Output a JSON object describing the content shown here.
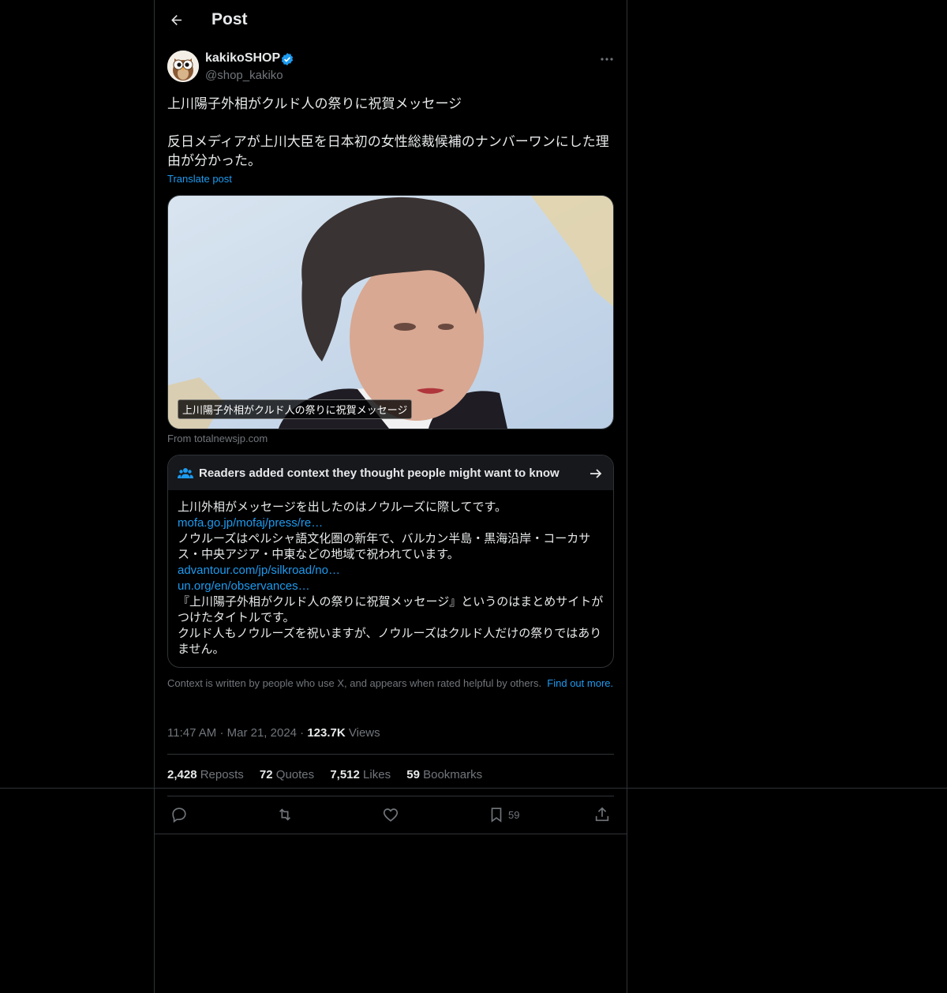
{
  "header": {
    "title": "Post"
  },
  "author": {
    "name": "kakikoSHOP",
    "handle": "@shop_kakiko"
  },
  "post": {
    "text": "上川陽子外相がクルド人の祭りに祝賀メッセージ\n\n反日メディアが上川大臣を日本初の女性総裁候補のナンバーワンにした理由が分かった。",
    "translate_label": "Translate post",
    "media_caption": "上川陽子外相がクルド人の祭りに祝賀メッセージ",
    "source": "From totalnewsjp.com"
  },
  "community_note": {
    "title": "Readers added context they thought people might want to know",
    "line1": "上川外相がメッセージを出したのはノウルーズに際してです。",
    "link1": "mofa.go.jp/mofaj/press/re…",
    "line2": "ノウルーズはペルシャ語文化圏の新年で、バルカン半島・黒海沿岸・コーカサス・中央アジア・中東などの地域で祝われています。",
    "link2": "advantour.com/jp/silkroad/no…",
    "link3": "un.org/en/observances…",
    "line3": "『上川陽子外相がクルド人の祭りに祝賀メッセージ』というのはまとめサイトがつけたタイトルです。",
    "line4": "クルド人もノウルーズを祝いますが、ノウルーズはクルド人だけの祭りではありません。"
  },
  "context_footer": {
    "text": "Context is written by people who use X, and appears when rated helpful by others.",
    "link": "Find out more."
  },
  "meta": {
    "time": "11:47 AM",
    "date": "Mar 21, 2024",
    "views_count": "123.7K",
    "views_label": "Views"
  },
  "stats": {
    "reposts_count": "2,428",
    "reposts_label": "Reposts",
    "quotes_count": "72",
    "quotes_label": "Quotes",
    "likes_count": "7,512",
    "likes_label": "Likes",
    "bookmarks_count": "59",
    "bookmarks_label": "Bookmarks"
  },
  "actions": {
    "bookmark_count": "59"
  },
  "colors": {
    "accent": "#1d9bf0",
    "background": "#000000",
    "border": "#2f3336",
    "muted": "#71767b"
  }
}
